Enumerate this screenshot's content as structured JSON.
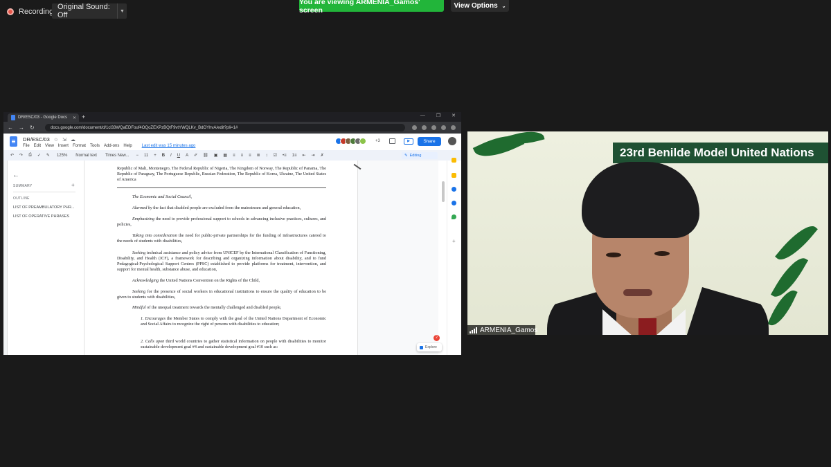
{
  "zoom_bar": {
    "recording": "Recording",
    "original_sound": "Original Sound: Off",
    "viewing_banner": "You are viewing ARMENIA_Gamos' screen",
    "view_options": "View Options"
  },
  "browser": {
    "tab_title": "DR/ESC/03 - Google Docs",
    "url": "docs.google.com/document/d/1cl33WQaEDFouf4OQoZEXPzBQtF9vtYWQLKv_BdOYhvA/edit?pli=1#"
  },
  "docs": {
    "title": "DR/ESC/03",
    "menus": [
      "File",
      "Edit",
      "View",
      "Insert",
      "Format",
      "Tools",
      "Add-ons",
      "Help"
    ],
    "last_edit": "Last edit was 15 minutes ago",
    "collaborator_count": "+3",
    "share": "Share",
    "toolbar": {
      "zoom": "125%",
      "style": "Normal text",
      "font": "Times New...",
      "size": "11",
      "bold": "B",
      "italic": "I",
      "underline": "U",
      "text_color": "A",
      "mode": "Editing"
    },
    "outline": {
      "summary_title": "SUMMARY",
      "outline_title": "OUTLINE",
      "items": [
        "LIST OF PREAMBULATORY PHR...",
        "LIST OF OPERATIVE PHRASES"
      ]
    },
    "explore": "Explore",
    "notification_count": "2",
    "body": {
      "sponsors": "Republic of Mali, Montenegro, The Federal Republic of Nigeria, The Kingdom of Norway, The Republic of Panama, The Republic of Paraguay, The Portuguese Republic, Russian Federation, The Republic of Korea, Ukraine, The United States of America",
      "council": "The Economic and Social Council,",
      "p1_lead": "Alarmed by",
      "p1_rest": " the fact that disabled people are excluded from the mainstream and general education,",
      "p2_lead": "Emphasizing",
      "p2_rest": " the need to provide professional support to schools in advancing inclusive practices, cultures, and policies,",
      "p3_lead": "Taking into consideration",
      "p3_rest": " the need for public-private partnerships for the funding of infrastructures catered to the needs of students with disabilities,",
      "p4_lead": "Seeking",
      "p4_rest": " technical assistance and policy advice from UNICEF by the International Classification of Functioning, Disability, and Health (ICF), a framework for describing and organizing information about disability, and to fund Pedagogical-Psychological Support Centres (PPSC) established to provide platforms for treatment, intervention, and support for mental health, substance abuse, and education,",
      "p5_lead": "Acknowledging",
      "p5_rest": " the United Nations Convention on the Rights of the Child,",
      "p6_lead": "Seeking",
      "p6_rest": " for the presence of social workers in educational institutions to ensure the quality of education to be given to students with disabilities,",
      "p7_lead": "Mindful",
      "p7_rest": " of the unequal treatment towards the mentally challenged and disabled people,",
      "op1_lead": "1. Encourages",
      "op1_rest": " the Member States to comply with the goal of the United Nations Department of Economic and Social Affairs to recognize the right of persons with disabilities to education;",
      "op2_lead": "2. Calls upon",
      "op2_rest": " third world countries to gather statistical information on people with disabilities to monitor sustainable development goal #4 and sustainable development goal #10 such as:"
    }
  },
  "video": {
    "banner": "23rd Benilde Model United Nations",
    "participant": "ARMENIA_Gamos"
  },
  "colors": {
    "zoom_green": "#22b53a",
    "docs_blue": "#1a73e8",
    "banner_green": "#1f5133"
  }
}
